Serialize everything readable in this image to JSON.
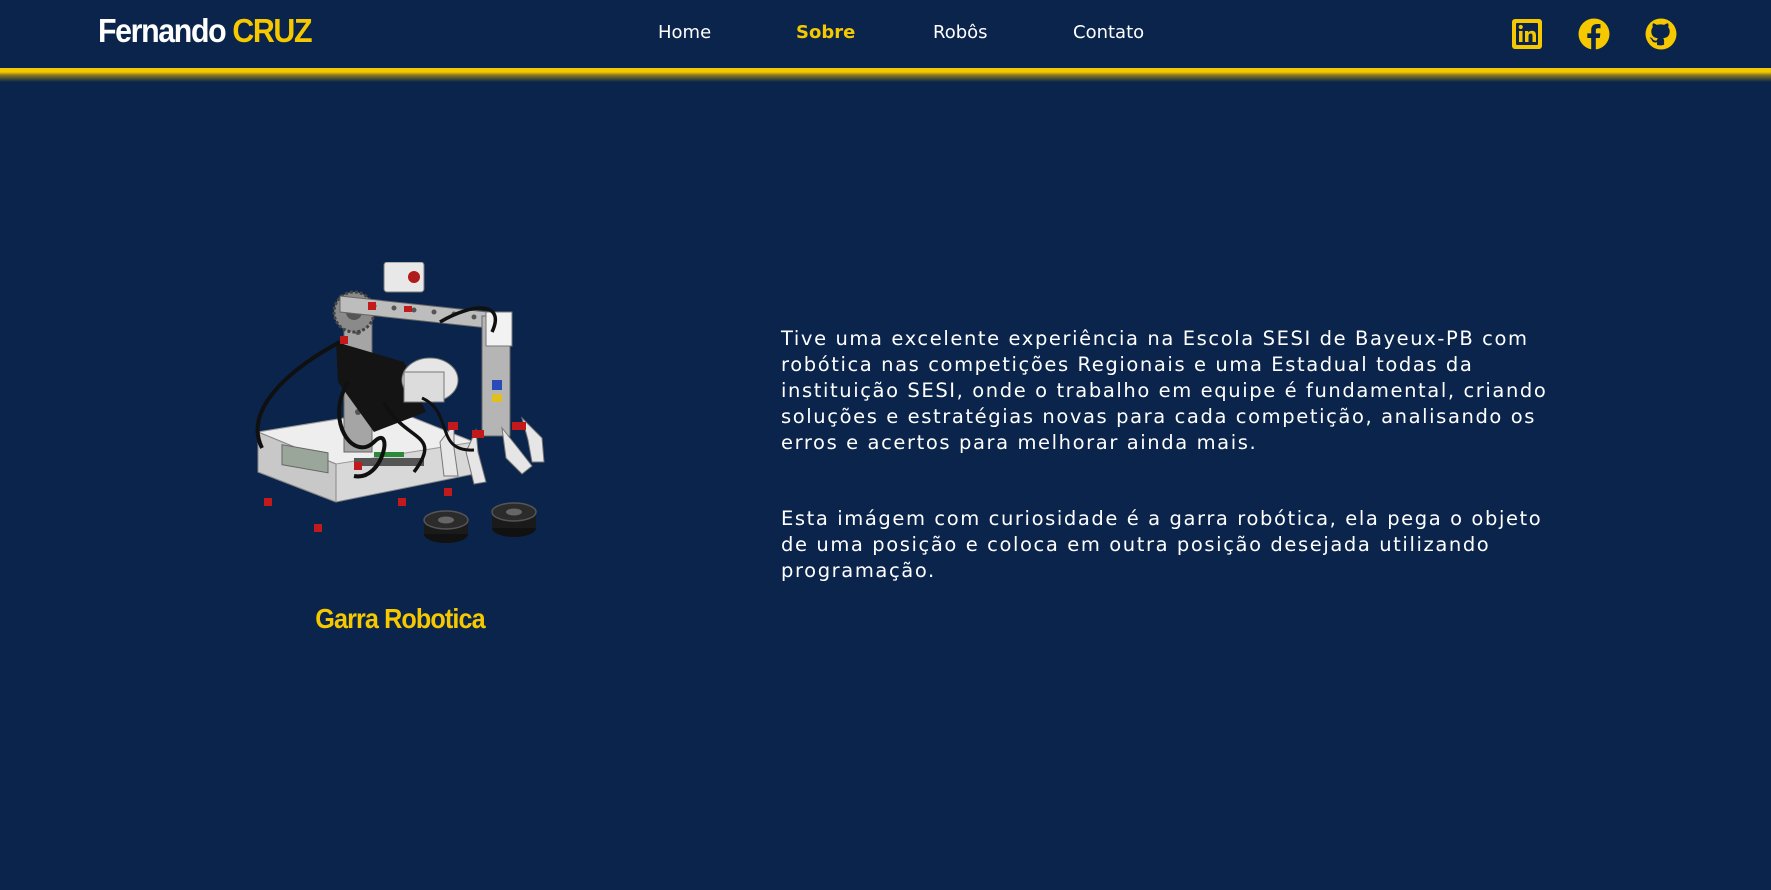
{
  "header": {
    "logo_first": "Fernando",
    "logo_last": "CRUZ",
    "nav": [
      {
        "label": "Home",
        "active": false
      },
      {
        "label": "Sobre",
        "active": true
      },
      {
        "label": "Robôs",
        "active": false
      },
      {
        "label": "Contato",
        "active": false
      }
    ],
    "social_icons": [
      "linkedin-icon",
      "facebook-icon",
      "github-icon"
    ]
  },
  "main": {
    "image_caption": "Garra Robotica",
    "paragraphs": [
      "Tive uma excelente experiência na Escola SESI de Bayeux-PB com robótica nas competições Regionais e uma Estadual todas da instituição SESI, onde o trabalho em equipe é fundamental, criando soluções e estratégias novas para cada competição, analisando os erros e acertos para melhorar ainda mais.",
      "Esta imágem com curiosidade é a garra robótica, ela pega o objeto de uma posição e coloca em outra posição desejada utilizando programação."
    ]
  },
  "colors": {
    "background": "#0a244b",
    "accent": "#f5c800",
    "text": "#ffffff"
  }
}
